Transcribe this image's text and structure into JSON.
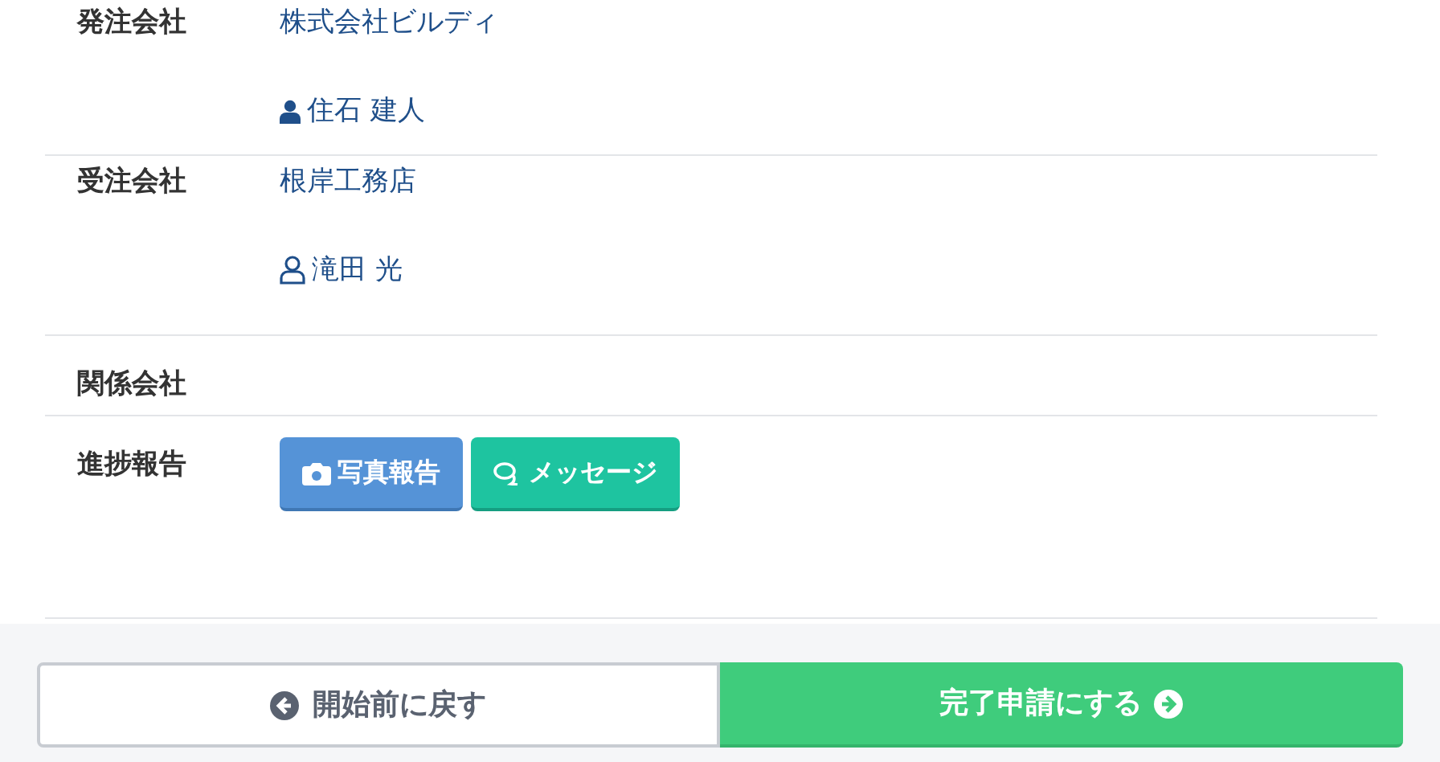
{
  "rows": [
    {
      "kind": "party",
      "label": "発注会社",
      "company": "株式会社ビルディ",
      "contact": {
        "name": "住石 建人",
        "kind": "solid"
      }
    },
    {
      "kind": "party",
      "label": "受注会社",
      "company": "根岸工務店",
      "contact": {
        "name": "滝田 光",
        "kind": "outline"
      }
    },
    {
      "kind": "empty",
      "label": "関係会社"
    },
    {
      "kind": "actions",
      "label": "進捗報告",
      "buttons": [
        {
          "kind": "photo",
          "label": "写真報告"
        },
        {
          "kind": "message",
          "label": "メッセージ"
        }
      ]
    }
  ],
  "footer": {
    "back": "開始前に戻す",
    "complete": "完了申請にする"
  }
}
